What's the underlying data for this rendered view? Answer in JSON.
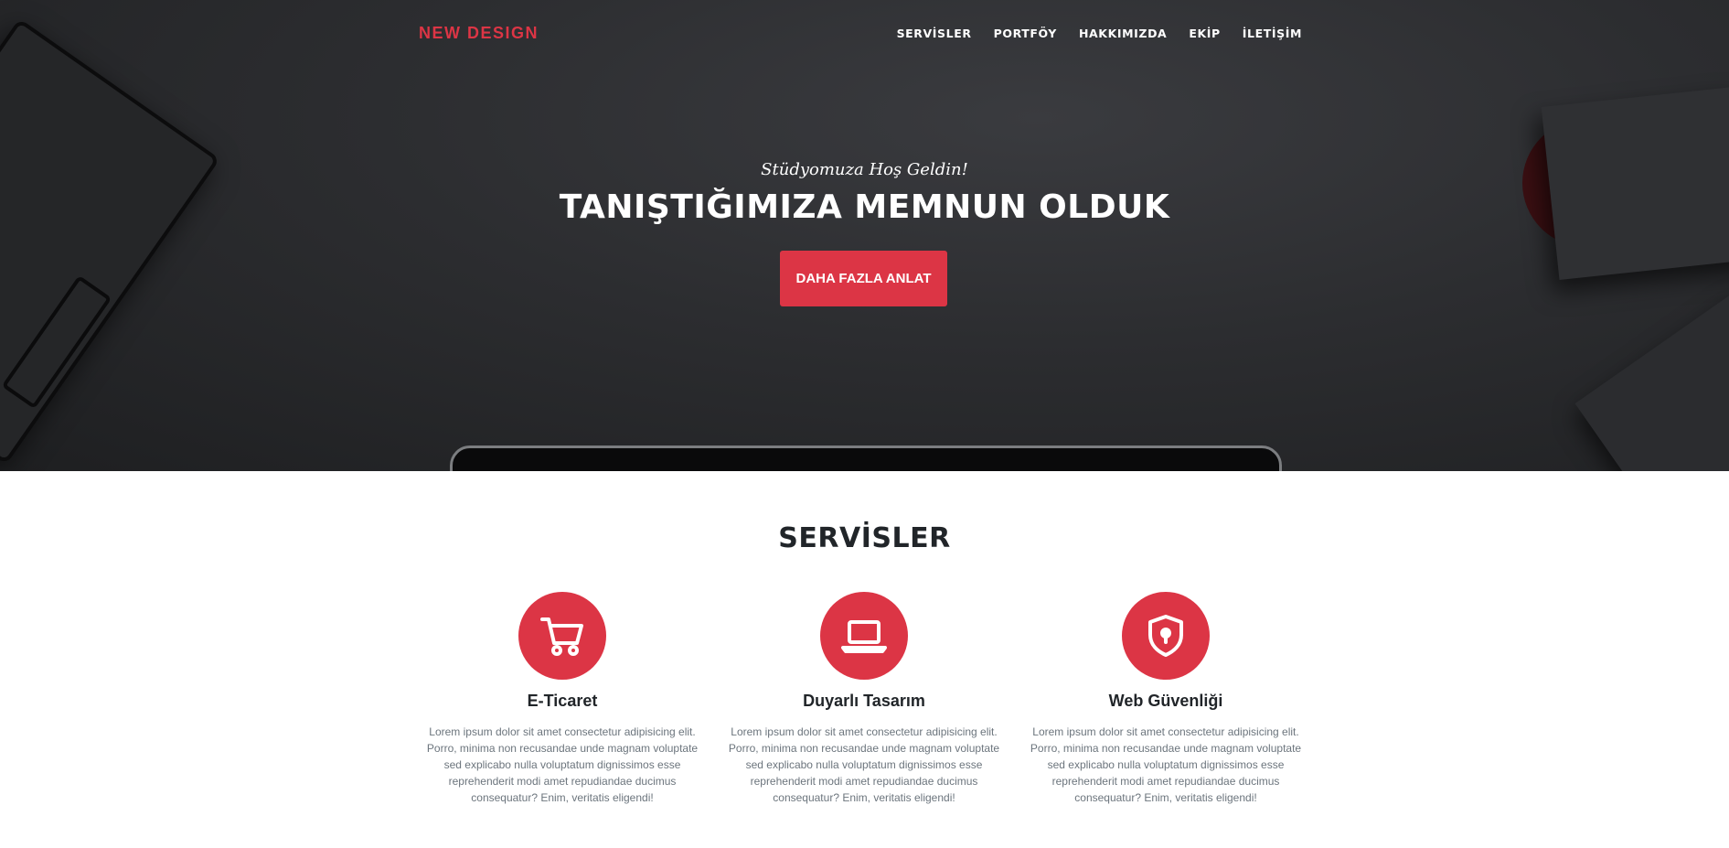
{
  "nav": {
    "brand": "NEW DESIGN",
    "items": [
      {
        "label": "SERVİSLER"
      },
      {
        "label": "PORTFÖY"
      },
      {
        "label": "HAKKIMIZDA"
      },
      {
        "label": "EKİP"
      },
      {
        "label": "İLETİŞİM"
      }
    ]
  },
  "hero": {
    "subheading": "Stüdyomuza Hoş Geldin!",
    "heading": "TANIŞTIĞIMIZA MEMNUN OLDUK",
    "button_label": "DAHA FAZLA ANLAT"
  },
  "services": {
    "title": "SERVİSLER",
    "items": [
      {
        "icon": "shopping-cart-icon",
        "title": "E-Ticaret",
        "text": "Lorem ipsum dolor sit amet consectetur adipisicing elit. Porro, minima non recusandae unde magnam voluptate sed explicabo nulla voluptatum dignissimos esse reprehenderit modi amet repudiandae ducimus consequatur? Enim, veritatis eligendi!"
      },
      {
        "icon": "laptop-icon",
        "title": "Duyarlı Tasarım",
        "text": "Lorem ipsum dolor sit amet consectetur adipisicing elit. Porro, minima non recusandae unde magnam voluptate sed explicabo nulla voluptatum dignissimos esse reprehenderit modi amet repudiandae ducimus consequatur? Enim, veritatis eligendi!"
      },
      {
        "icon": "shield-lock-icon",
        "title": "Web Güvenliği",
        "text": "Lorem ipsum dolor sit amet consectetur adipisicing elit. Porro, minima non recusandae unde magnam voluptate sed explicabo nulla voluptatum dignissimos esse reprehenderit modi amet repudiandae ducimus consequatur? Enim, veritatis eligendi!"
      }
    ]
  },
  "colors": {
    "accent": "#dc3545",
    "hero_bg": "#2c2d30",
    "text_dark": "#212529",
    "text_muted": "#6c757d"
  }
}
